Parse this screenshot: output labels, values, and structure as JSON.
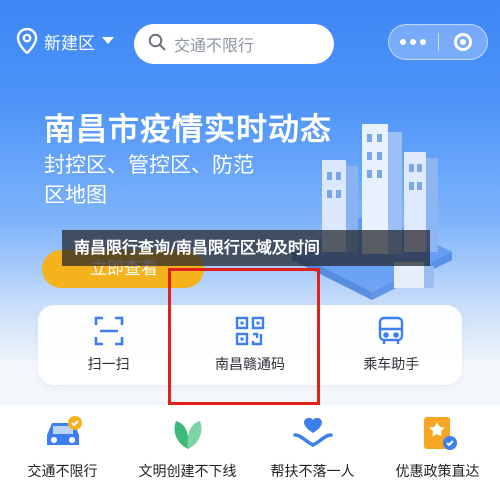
{
  "header": {
    "location": "新建区",
    "search_placeholder": "交通不限行"
  },
  "banner": {
    "title": "南昌市疫情实时动态",
    "subtitle": "封控区、管控区、防范区地图",
    "button": "立即查看"
  },
  "overlay_title": "南昌限行查询/南昌限行区域及时间",
  "quick_actions": [
    {
      "label": "扫一扫",
      "icon": "scan-icon"
    },
    {
      "label": "南昌赣通码",
      "icon": "qrcode-icon"
    },
    {
      "label": "乘车助手",
      "icon": "bus-icon"
    }
  ],
  "services": [
    {
      "label": "交通不限行",
      "icon": "car-icon"
    },
    {
      "label": "文明创建不下线",
      "icon": "leaf-icon"
    },
    {
      "label": "帮扶不落一人",
      "icon": "heart-hands-icon"
    },
    {
      "label": "优惠政策直达",
      "icon": "document-star-icon"
    }
  ],
  "colors": {
    "primary": "#3d86f6",
    "accent": "#f6b21c",
    "highlight": "#e0201b"
  }
}
